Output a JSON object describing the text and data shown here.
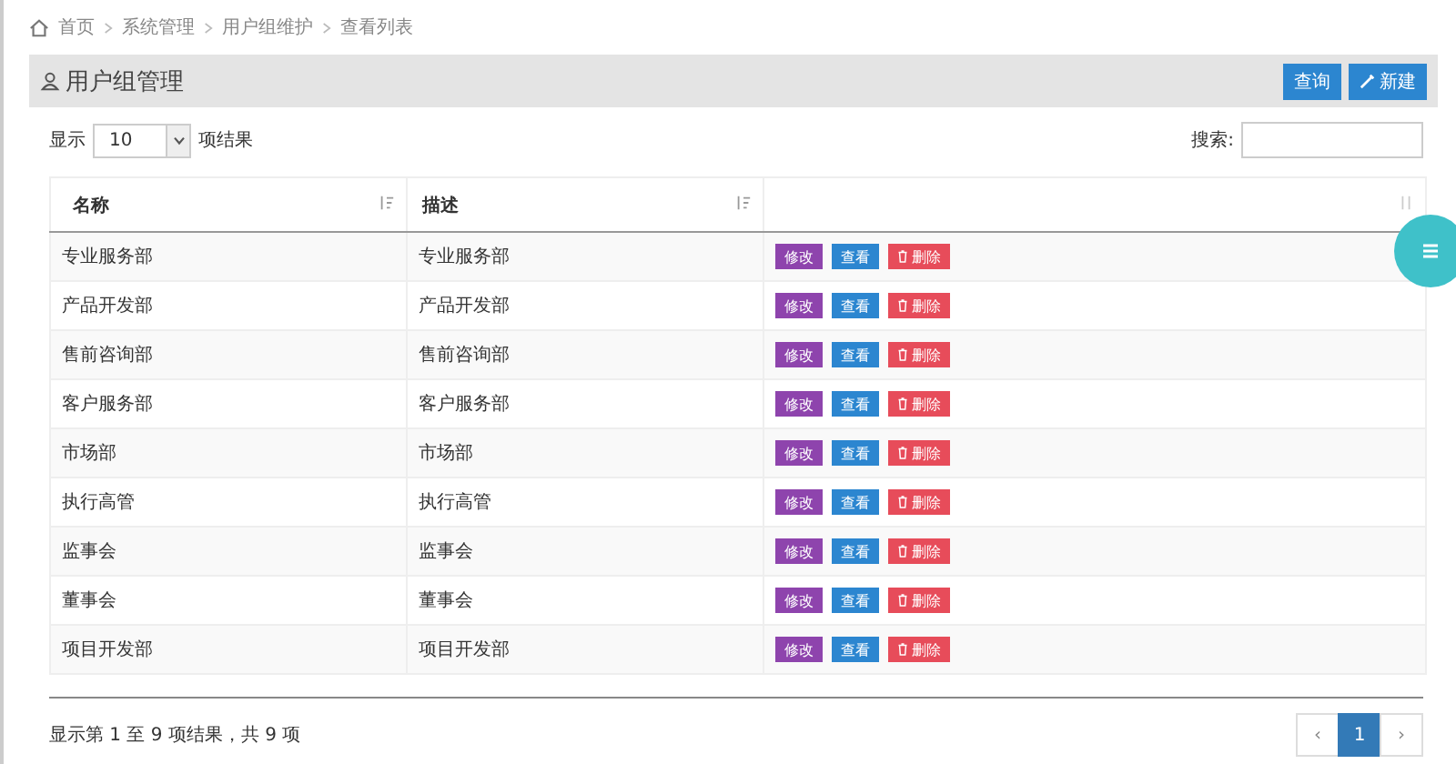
{
  "breadcrumb": [
    "首页",
    "系统管理",
    "用户组维护",
    "查看列表"
  ],
  "header": {
    "title": "用户组管理",
    "buttons": [
      "查询",
      "新建"
    ]
  },
  "length_control": {
    "before": "显示",
    "value": "10",
    "after": "项结果"
  },
  "search": {
    "label": "搜索:"
  },
  "table": {
    "columns": [
      "名称",
      "描述"
    ],
    "rows": [
      {
        "name": "专业服务部",
        "description": "专业服务部",
        "actions": [
          "修改",
          "查看",
          "删除"
        ]
      },
      {
        "name": "产品开发部",
        "description": "产品开发部",
        "actions": [
          "修改",
          "查看",
          "删除"
        ]
      },
      {
        "name": "售前咨询部",
        "description": "售前咨询部",
        "actions": [
          "修改",
          "查看",
          "删除"
        ]
      },
      {
        "name": "客户服务部",
        "description": "客户服务部",
        "actions": [
          "修改",
          "查看",
          "删除"
        ]
      },
      {
        "name": "市场部",
        "description": "市场部",
        "actions": [
          "修改",
          "查看",
          "删除"
        ]
      },
      {
        "name": "执行高管",
        "description": "执行高管",
        "actions": [
          "修改",
          "查看",
          "删除"
        ]
      },
      {
        "name": "监事会",
        "description": "监事会",
        "actions": [
          "修改",
          "查看",
          "删除"
        ]
      },
      {
        "name": "董事会",
        "description": "董事会",
        "actions": [
          "修改",
          "查看",
          "删除"
        ]
      },
      {
        "name": "项目开发部",
        "description": "项目开发部",
        "actions": [
          "修改",
          "查看",
          "删除"
        ]
      }
    ]
  },
  "footer": {
    "info": "显示第 1 至 9 项结果，共 9 项",
    "pagination": {
      "prev": "‹",
      "pages": [
        {
          "label": "1",
          "selected": true
        }
      ],
      "next": "›"
    }
  }
}
